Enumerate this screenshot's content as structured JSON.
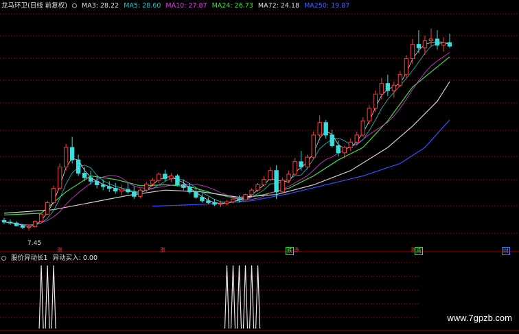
{
  "title": "龙马环卫(日线 前复权)",
  "ma_labels": [
    {
      "key": "MA3",
      "text": "MA3: 28.22",
      "color": "#e0e0e0"
    },
    {
      "key": "MA5",
      "text": "MA5: 28.60",
      "color": "#29c2c2"
    },
    {
      "key": "MA10",
      "text": "MA10: 27.87",
      "color": "#e040e0"
    },
    {
      "key": "MA24",
      "text": "MA24: 26.73",
      "color": "#40e040"
    },
    {
      "key": "MA72",
      "text": "MA72: 24.18",
      "color": "#e0e0e0"
    },
    {
      "key": "MA250",
      "text": "MA250: 19.87",
      "color": "#4060ff"
    }
  ],
  "low_label": "7.45",
  "indicator_title": "股价异动长1",
  "indicator_value": "异动买入: 0.00",
  "signals": [
    {
      "text": "涨",
      "color": "#e04040"
    },
    {
      "text": "跌",
      "color": "#40e040"
    },
    {
      "text": "赤",
      "color": "#e04040"
    },
    {
      "text": "减",
      "color": "#40e040"
    },
    {
      "text": "财",
      "color": "#4080ff"
    }
  ],
  "watermark": "www.7gpzb.com",
  "colors": {
    "up": "#ff3c3c",
    "down": "#3cdcdc",
    "grid": "#8b0000",
    "axis": "#a00000"
  },
  "chart_data": {
    "type": "candlestick",
    "ylim": [
      6,
      32
    ],
    "candles": [
      [
        8.6,
        8.9,
        8.2,
        8.4
      ],
      [
        8.4,
        8.7,
        8.1,
        8.3
      ],
      [
        8.3,
        8.5,
        7.9,
        8.0
      ],
      [
        8.0,
        8.2,
        7.6,
        7.8
      ],
      [
        7.8,
        8.1,
        7.45,
        7.9
      ],
      [
        7.9,
        8.6,
        7.8,
        8.5
      ],
      [
        8.5,
        9.4,
        8.4,
        9.3
      ],
      [
        9.3,
        10.8,
        9.2,
        10.6
      ],
      [
        10.6,
        12.5,
        10.4,
        12.2
      ],
      [
        12.2,
        15.0,
        12.0,
        14.6
      ],
      [
        14.6,
        17.2,
        14.2,
        16.8
      ],
      [
        16.8,
        18.0,
        15.0,
        15.4
      ],
      [
        15.4,
        16.0,
        13.6,
        13.9
      ],
      [
        13.9,
        14.6,
        13.0,
        13.4
      ],
      [
        13.4,
        14.2,
        12.6,
        13.0
      ],
      [
        13.0,
        13.6,
        12.2,
        12.6
      ],
      [
        12.6,
        13.2,
        12.0,
        12.4
      ],
      [
        12.4,
        13.0,
        11.8,
        12.2
      ],
      [
        12.2,
        12.8,
        11.6,
        11.9
      ],
      [
        11.9,
        12.6,
        11.4,
        12.1
      ],
      [
        12.1,
        12.8,
        11.6,
        11.8
      ],
      [
        11.8,
        12.4,
        11.0,
        11.3
      ],
      [
        11.3,
        12.2,
        11.1,
        12.0
      ],
      [
        12.0,
        12.9,
        11.8,
        12.7
      ],
      [
        12.7,
        13.4,
        12.4,
        13.1
      ],
      [
        13.1,
        14.0,
        12.8,
        13.8
      ],
      [
        13.8,
        14.3,
        13.0,
        13.3
      ],
      [
        13.3,
        13.9,
        12.9,
        13.6
      ],
      [
        13.6,
        13.8,
        12.4,
        12.6
      ],
      [
        12.6,
        13.2,
        12.0,
        12.3
      ],
      [
        12.3,
        12.8,
        11.6,
        11.8
      ],
      [
        11.8,
        12.2,
        11.0,
        11.2
      ],
      [
        11.2,
        11.6,
        10.6,
        10.8
      ],
      [
        10.8,
        11.2,
        10.4,
        10.6
      ],
      [
        10.6,
        11.0,
        10.2,
        10.4
      ],
      [
        10.4,
        10.8,
        10.1,
        10.5
      ],
      [
        10.5,
        10.9,
        10.3,
        10.7
      ],
      [
        10.7,
        11.2,
        10.5,
        11.0
      ],
      [
        11.0,
        11.4,
        10.6,
        10.9
      ],
      [
        10.9,
        11.6,
        10.8,
        11.5
      ],
      [
        11.5,
        12.2,
        11.3,
        12.0
      ],
      [
        12.0,
        12.8,
        11.8,
        12.6
      ],
      [
        12.6,
        13.6,
        12.4,
        13.2
      ],
      [
        13.2,
        14.6,
        13.0,
        14.2
      ],
      [
        14.2,
        14.8,
        11.0,
        11.8
      ],
      [
        11.8,
        13.4,
        11.6,
        13.1
      ],
      [
        13.1,
        14.2,
        12.8,
        13.8
      ],
      [
        13.8,
        15.6,
        13.6,
        15.2
      ],
      [
        15.2,
        16.4,
        14.2,
        14.6
      ],
      [
        14.6,
        16.0,
        14.3,
        15.7
      ],
      [
        15.7,
        18.6,
        15.5,
        18.2
      ],
      [
        18.2,
        20.4,
        17.6,
        19.6
      ],
      [
        19.6,
        19.9,
        17.8,
        18.2
      ],
      [
        18.2,
        18.8,
        16.8,
        17.0
      ],
      [
        17.0,
        17.6,
        15.8,
        16.2
      ],
      [
        16.2,
        17.0,
        15.6,
        16.8
      ],
      [
        16.8,
        17.8,
        16.4,
        17.4
      ],
      [
        17.4,
        18.6,
        17.0,
        18.2
      ],
      [
        18.2,
        20.2,
        18.0,
        19.8
      ],
      [
        19.8,
        21.6,
        19.4,
        21.2
      ],
      [
        21.2,
        23.2,
        20.8,
        22.8
      ],
      [
        22.8,
        24.6,
        22.2,
        24.0
      ],
      [
        24.0,
        25.0,
        22.6,
        23.2
      ],
      [
        23.2,
        24.2,
        22.4,
        23.8
      ],
      [
        23.8,
        25.4,
        23.6,
        25.0
      ],
      [
        25.0,
        27.2,
        24.6,
        26.8
      ],
      [
        26.8,
        29.0,
        26.2,
        28.4
      ],
      [
        28.4,
        30.0,
        27.4,
        28.0
      ],
      [
        28.0,
        29.4,
        27.2,
        28.8
      ],
      [
        28.8,
        30.2,
        28.2,
        29.0
      ],
      [
        29.0,
        30.0,
        27.8,
        28.3
      ],
      [
        28.3,
        29.2,
        27.6,
        28.6
      ],
      [
        28.6,
        29.6,
        28.0,
        28.2
      ]
    ],
    "ma_series": [
      {
        "name": "MA24",
        "color": "#40e040",
        "values": [
          [
            0,
            9.2
          ],
          [
            6,
            9.4
          ],
          [
            10,
            11.8
          ],
          [
            14,
            13.6
          ],
          [
            18,
            13.2
          ],
          [
            22,
            12.5
          ],
          [
            26,
            12.6
          ],
          [
            30,
            12.4
          ],
          [
            34,
            11.6
          ],
          [
            38,
            11.0
          ],
          [
            42,
            11.5
          ],
          [
            46,
            12.2
          ],
          [
            50,
            13.6
          ],
          [
            54,
            15.4
          ],
          [
            58,
            16.8
          ],
          [
            62,
            19.8
          ],
          [
            66,
            23.6
          ],
          [
            72,
            27.0
          ]
        ]
      },
      {
        "name": "MA72",
        "color": "#d0d0d0",
        "values": [
          [
            0,
            9.4
          ],
          [
            8,
            9.8
          ],
          [
            14,
            10.6
          ],
          [
            20,
            11.4
          ],
          [
            26,
            12.0
          ],
          [
            32,
            11.8
          ],
          [
            38,
            11.2
          ],
          [
            44,
            11.5
          ],
          [
            50,
            12.6
          ],
          [
            56,
            14.2
          ],
          [
            62,
            16.8
          ],
          [
            66,
            19.2
          ],
          [
            70,
            22.0
          ],
          [
            72,
            24.2
          ]
        ]
      },
      {
        "name": "MA250",
        "color": "#3050ff",
        "values": [
          [
            24,
            10.2
          ],
          [
            32,
            10.4
          ],
          [
            40,
            10.8
          ],
          [
            46,
            11.6
          ],
          [
            52,
            12.6
          ],
          [
            58,
            13.6
          ],
          [
            64,
            15.0
          ],
          [
            68,
            16.8
          ],
          [
            72,
            19.9
          ]
        ]
      }
    ],
    "indicator": {
      "ylim": [
        0,
        1
      ],
      "spikes_at": [
        6,
        7,
        8,
        36,
        37,
        38,
        39,
        40,
        41
      ]
    }
  }
}
